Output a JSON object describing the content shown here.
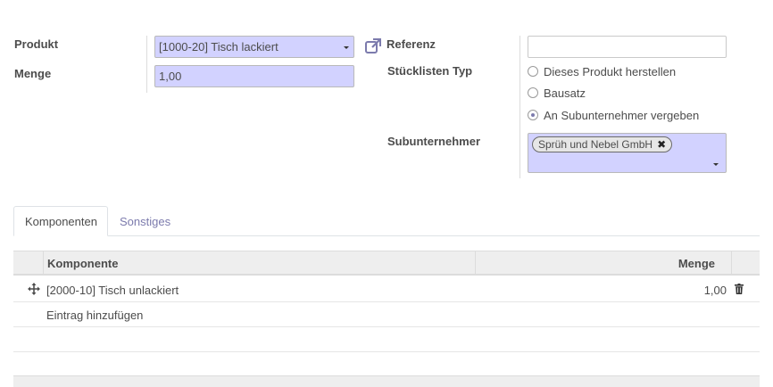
{
  "form": {
    "product_label": "Produkt",
    "product_value": "[1000-20] Tisch lackiert",
    "quantity_label": "Menge",
    "quantity_value": "1,00",
    "reference_label": "Referenz",
    "reference_value": "",
    "bom_type_label": "Stücklisten Typ",
    "bom_type_options": [
      {
        "label": "Dieses Produkt herstellen",
        "selected": false
      },
      {
        "label": "Bausatz",
        "selected": false
      },
      {
        "label": "An Subunternehmer vergeben",
        "selected": true
      }
    ],
    "subcontractor_label": "Subunternehmer",
    "subcontractor_tags": [
      "Sprüh und Nebel GmbH"
    ]
  },
  "tabs": [
    {
      "label": "Komponenten",
      "active": true
    },
    {
      "label": "Sonstiges",
      "active": false
    }
  ],
  "table": {
    "columns": [
      "Komponente",
      "Menge"
    ],
    "rows": [
      {
        "component": "[2000-10] Tisch unlackiert",
        "quantity": "1,00"
      }
    ],
    "add_line_label": "Eintrag hinzufügen"
  },
  "colors": {
    "field_bg": "#d2d2ff",
    "accent": "#7c7bad",
    "header_bg": "#eeeeee"
  }
}
